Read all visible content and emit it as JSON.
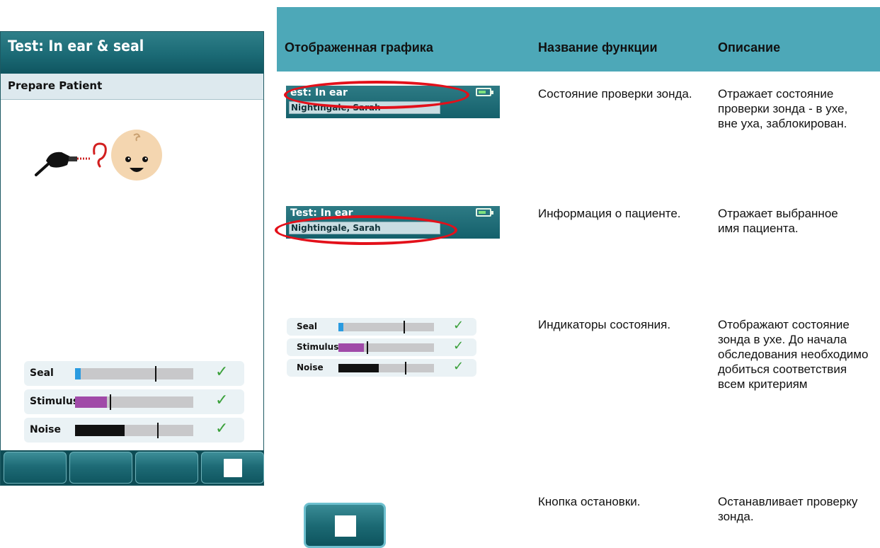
{
  "device": {
    "title": "Test: In ear & seal",
    "subtitle": "Prepare Patient",
    "indicators": [
      {
        "label": "Seal",
        "level": 0.05,
        "threshold": 0.65,
        "color": "#2a9be0",
        "status": "✓"
      },
      {
        "label": "Stimulus",
        "level": 0.27,
        "threshold": 0.27,
        "color": "#a04aa8",
        "status": "✓"
      },
      {
        "label": "Noise",
        "level": 0.42,
        "threshold": 0.67,
        "color": "#111111",
        "status": "✓"
      }
    ],
    "buttons": [
      "",
      "",
      "",
      "stop-icon"
    ]
  },
  "table": {
    "headers": {
      "graphic": "Отображенная графика",
      "function": "Название функции",
      "description": "Описание"
    },
    "rows": [
      {
        "function": "Состояние проверки зонда.",
        "description": "Отражает состояние проверки зонда - в ухе, вне уха, заблокирован."
      },
      {
        "function": "Информация о пациенте.",
        "description": "Отражает выбранное имя пациента."
      },
      {
        "function": "Индикаторы состояния.",
        "description": "Отображают состояние зонда в ухе. До начала обследования необходимо добиться соответствия всем критериям"
      },
      {
        "function": "Кнопка остановки.",
        "description": "Останавливает проверку зонда."
      }
    ]
  },
  "mini": {
    "header_title": "Test: In ear",
    "header_title_cropped": "est: In ear",
    "patient_name": "Nightingale, Sarah"
  },
  "colors": {
    "header_teal": "#4da8b8",
    "device_teal": "#1b6a75",
    "highlight_red": "#e3101a",
    "check_green": "#3aa03a"
  }
}
